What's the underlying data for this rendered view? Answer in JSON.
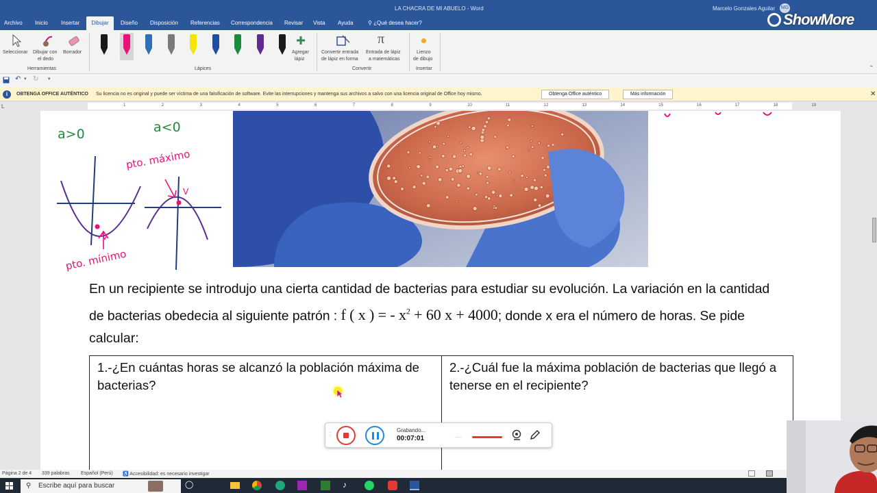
{
  "titlebar": {
    "document": "LA CHACRA DE MI ABUELO - Word",
    "user": "Marcelo Gonzales Aguilar",
    "initials": "MG",
    "watermark": "ShowMore"
  },
  "tabs": [
    "Archivo",
    "Inicio",
    "Insertar",
    "Dibujar",
    "Diseño",
    "Disposición",
    "Referencias",
    "Correspondencia",
    "Revisar",
    "Vista",
    "Ayuda"
  ],
  "tell_me": "¿Qué desea hacer?",
  "ribbon": {
    "tools": {
      "select": "Seleccionar",
      "finger_1": "Dibujar con",
      "finger_2": "el dedo",
      "eraser": "Borrador",
      "group": "Herramientas"
    },
    "pens_group": "Lápices",
    "add_pen_1": "Agregar",
    "add_pen_2": "lápiz",
    "convert": {
      "ink_shape_1": "Convertir entrada",
      "ink_shape_2": "de lápiz en forma",
      "ink_math_1": "Entrada de lápiz",
      "ink_math_2": "a matemáticas",
      "group": "Convertir"
    },
    "canvas": {
      "label_1": "Lienzo",
      "label_2": "de dibujo",
      "group": "Insertar"
    },
    "pen_colors": [
      "#1a1a1a",
      "#e8127a",
      "#2f6fb5",
      "#7a7a7a",
      "#f5e50a",
      "#1f4f9e",
      "#1e8a3a",
      "#5b2d91",
      "#1a1a1a"
    ]
  },
  "infobar": {
    "title": "OBTENGA OFFICE AUTÉNTICO",
    "message": "Su licencia no es original y puede ser víctima de una falsificación de software. Evite las interrupciones y mantenga sus archivos a salvo con una licencia original de Office hoy mismo.",
    "btn_get": "Obtenga Office auténtico",
    "btn_more": "Más información"
  },
  "ruler_numbers": [
    "1",
    "2",
    "3",
    "4",
    "5",
    "6",
    "7",
    "8",
    "9",
    "10",
    "11",
    "12",
    "13",
    "14",
    "15",
    "16",
    "17",
    "18",
    "19"
  ],
  "sketch": {
    "a_pos": "a>0",
    "a_neg": "a<0",
    "max_label": "pto. máximo",
    "min_label": "pto. mínimo",
    "v_max": "V",
    "v_min": "V"
  },
  "paragraph": {
    "line1": "En un recipiente se introdujo una cierta cantidad de bacterias para estudiar su evolución. La variación en la cantidad",
    "line2_pre": "de bacterias  obedecia al siguiente patrón : ",
    "math": "f ( x ) = -  x",
    "math_sup": "2",
    "math_rest": " + 60 x + 4000",
    "line2_post": "; donde x era el número de horas. Se pide",
    "line3": "calcular:"
  },
  "table": {
    "q1": "1.-¿En cuántas horas se alcanzó la población máxima de bacterias?",
    "q2": "2.-¿Cuál fue la máxima población de bacterias que llegó a tenerse en el recipiente?"
  },
  "recorder": {
    "status": "Grabando...",
    "time": "00:07:01"
  },
  "statusbar": {
    "page": "Página 2 de 4",
    "words": "339 palabras",
    "language": "Español (Perú)",
    "accessibility": "Accesibilidad: es necesario investigar"
  },
  "taskbar": {
    "search": "Escribe aquí para buscar"
  }
}
